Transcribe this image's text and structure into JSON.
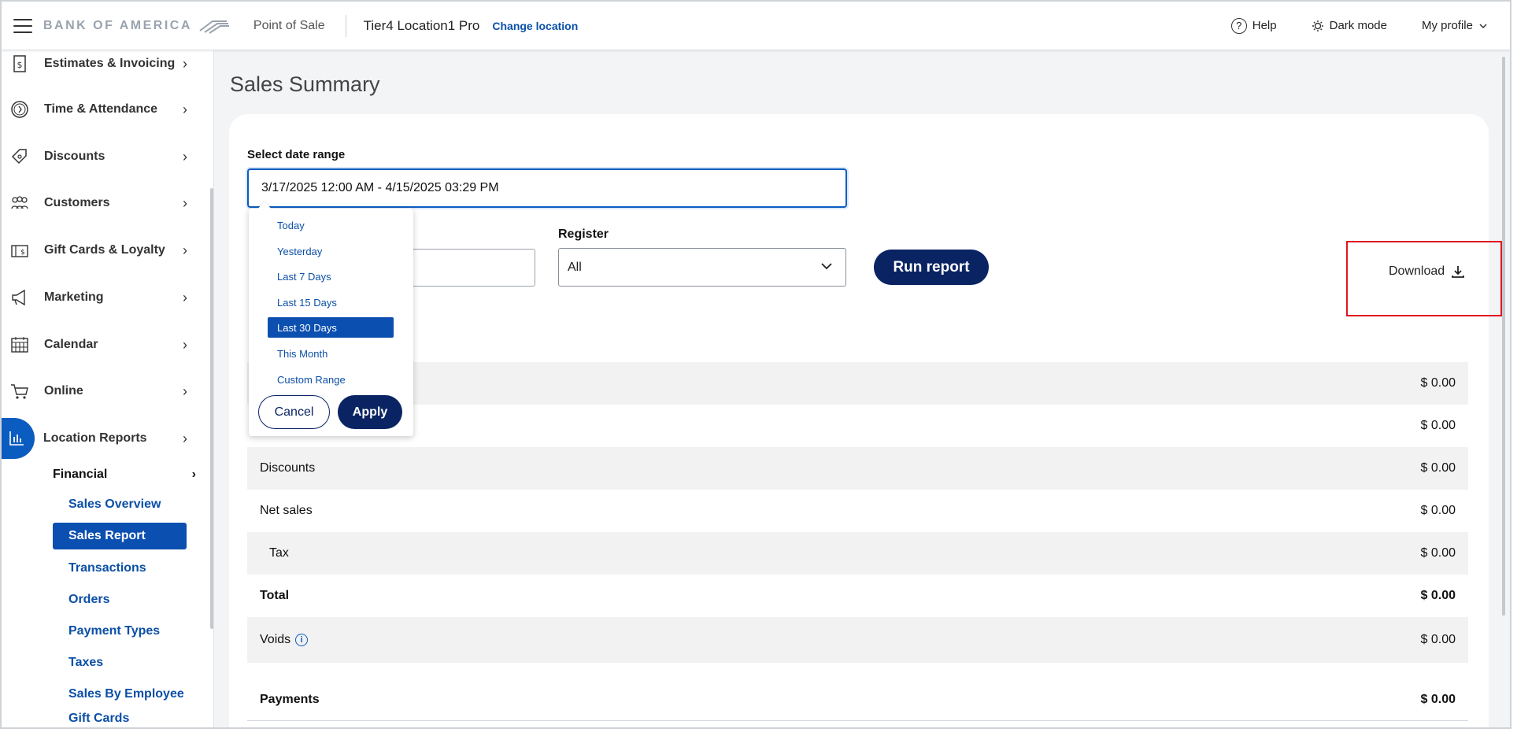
{
  "header": {
    "logo_text": "BANK OF AMERICA",
    "app_name": "Point of Sale",
    "location": "Tier4 Location1 Pro",
    "change_location": "Change location",
    "help": "Help",
    "dark_mode": "Dark mode",
    "my_profile": "My profile"
  },
  "sidebar": {
    "items": [
      {
        "label": "Estimates & Invoicing",
        "icon": "invoice-icon"
      },
      {
        "label": "Time & Attendance",
        "icon": "clock-icon"
      },
      {
        "label": "Discounts",
        "icon": "tag-icon"
      },
      {
        "label": "Customers",
        "icon": "people-icon"
      },
      {
        "label": "Gift Cards & Loyalty",
        "icon": "gift-card-icon"
      },
      {
        "label": "Marketing",
        "icon": "megaphone-icon"
      },
      {
        "label": "Calendar",
        "icon": "calendar-icon"
      },
      {
        "label": "Online",
        "icon": "cart-icon"
      },
      {
        "label": "Location Reports",
        "icon": "bar-chart-icon"
      }
    ],
    "sub_head": "Financial",
    "sub_items": [
      "Sales Overview",
      "Sales Report",
      "Transactions",
      "Orders",
      "Payment Types",
      "Taxes",
      "Sales By Employee",
      "Gift Cards Summary"
    ],
    "selected_sub": "Sales Report"
  },
  "main": {
    "title": "Sales Summary",
    "date_label": "Select date range",
    "date_value": "3/17/2025 12:00 AM - 4/15/2025 03:29 PM",
    "register_label": "Register",
    "register_value": "All",
    "run_report": "Run report",
    "download": "Download"
  },
  "dropdown": {
    "options": [
      "Today",
      "Yesterday",
      "Last 7 Days",
      "Last 15 Days",
      "Last 30 Days",
      "This Month",
      "Custom Range"
    ],
    "selected": "Last 30 Days",
    "cancel": "Cancel",
    "apply": "Apply"
  },
  "summary_rows": [
    {
      "label": "",
      "value": "$ 0.00"
    },
    {
      "label": "",
      "value": "$ 0.00"
    },
    {
      "label": "Discounts",
      "value": "$ 0.00"
    },
    {
      "label": "Net sales",
      "value": "$ 0.00"
    },
    {
      "label": "Tax",
      "value": "$ 0.00"
    },
    {
      "label": "Total",
      "value": "$ 0.00"
    },
    {
      "label": "Voids",
      "value": "$ 0.00"
    },
    {
      "label": "Payments",
      "value": "$ 0.00"
    }
  ],
  "colors": {
    "accent": "#0b5cc0",
    "navy": "#0a2463",
    "highlight": "#e0161f"
  }
}
